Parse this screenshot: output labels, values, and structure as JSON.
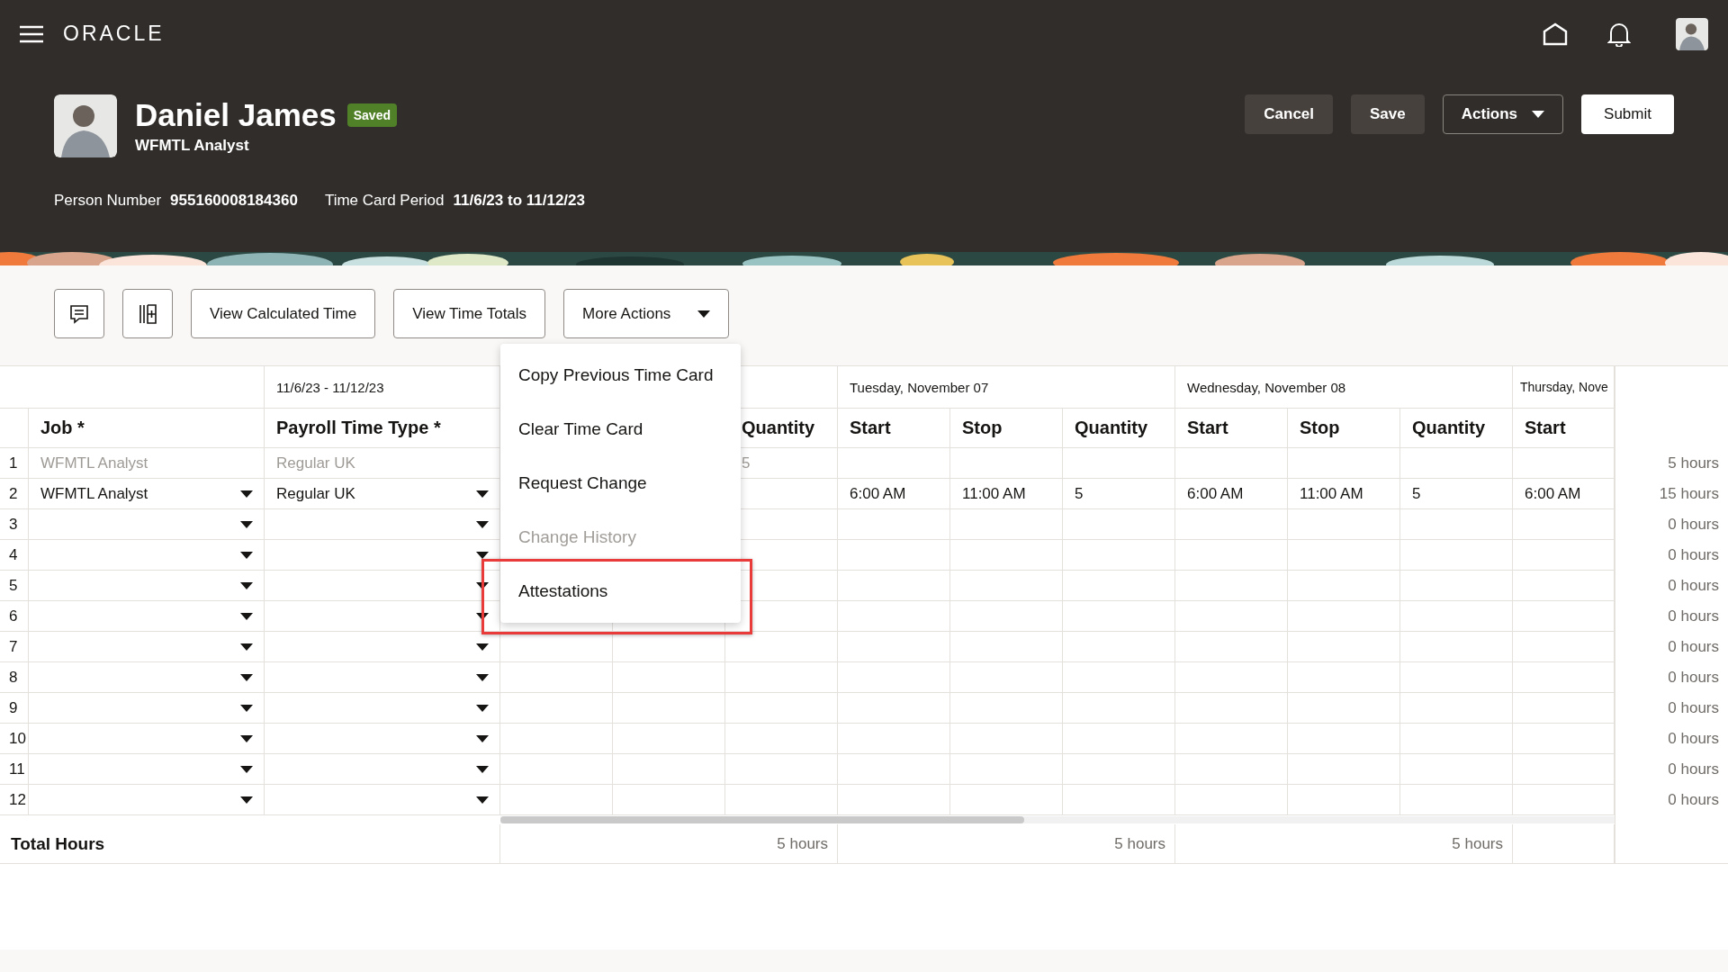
{
  "app_bar": {
    "logo": "ORACLE"
  },
  "person": {
    "name": "Daniel James",
    "status": "Saved",
    "title": "WFMTL Analyst",
    "details": [
      {
        "label": "Person Number",
        "value": "955160008184360"
      },
      {
        "label": "Time Card Period",
        "value": "11/6/23 to 11/12/23"
      }
    ]
  },
  "header_buttons": [
    {
      "label": "Cancel",
      "kind": "secondary"
    },
    {
      "label": "Save",
      "kind": "secondary"
    },
    {
      "label": "Actions",
      "kind": "menu"
    },
    {
      "label": "Submit",
      "kind": "primary"
    }
  ],
  "toolbar": [
    {
      "kind": "comment"
    },
    {
      "kind": "columns"
    },
    {
      "kind": "text",
      "label": "View Calculated Time"
    },
    {
      "kind": "text",
      "label": "View Time Totals"
    },
    {
      "kind": "menu",
      "label": "More Actions"
    }
  ],
  "table": {
    "period_header": "11/6/23 - 11/12/23",
    "day_groups": [
      {
        "label": "Tuesday, November 07"
      },
      {
        "label": "Wednesday, November 08"
      },
      {
        "label": "Thursday, Nove"
      }
    ],
    "columns": [
      "Job *",
      "Payroll Time Type *",
      "Quantity",
      "Start",
      "Stop",
      "Quantity",
      "Start",
      "Stop",
      "Quantity",
      "Start"
    ],
    "rows": [
      {
        "number": "1",
        "job": "WFMTL Analyst",
        "payroll_time_type": "Regular UK",
        "disabled": true,
        "entries": {
          "mon_quantity": "5"
        },
        "total": "5 hours"
      },
      {
        "number": "2",
        "job": "WFMTL Analyst",
        "payroll_time_type": "Regular UK",
        "disabled": false,
        "entries": {
          "tue_start": "6:00 AM",
          "tue_stop": "11:00 AM",
          "tue_quantity": "5",
          "wed_start": "6:00 AM",
          "wed_stop": "11:00 AM",
          "wed_quantity": "5",
          "thu_start": "6:00 AM"
        },
        "total": "15 hours"
      },
      {
        "number": "3",
        "disabled": false,
        "total": "0 hours"
      },
      {
        "number": "4",
        "disabled": false,
        "total": "0 hours"
      },
      {
        "number": "5",
        "disabled": false,
        "total": "0 hours"
      },
      {
        "number": "6",
        "disabled": false,
        "total": "0 hours"
      },
      {
        "number": "7",
        "disabled": false,
        "total": "0 hours"
      },
      {
        "number": "8",
        "disabled": false,
        "total": "0 hours"
      },
      {
        "number": "9",
        "disabled": false,
        "total": "0 hours"
      },
      {
        "number": "10",
        "disabled": false,
        "total": "0 hours"
      },
      {
        "number": "11",
        "disabled": false,
        "total": "0 hours"
      },
      {
        "number": "12",
        "disabled": false,
        "total": "0 hours"
      }
    ],
    "totals": {
      "label": "Total Hours",
      "day_totals": [
        "5 hours",
        "5 hours",
        "5 hours"
      ]
    }
  },
  "menu": {
    "items": [
      {
        "label": "Copy Previous Time Card",
        "disabled": false,
        "highlighted": false
      },
      {
        "label": "Clear Time Card",
        "disabled": false,
        "highlighted": false
      },
      {
        "label": "Request Change",
        "disabled": false,
        "highlighted": false
      },
      {
        "label": "Change History",
        "disabled": true,
        "highlighted": false
      },
      {
        "label": "Attestations",
        "disabled": false,
        "highlighted": true
      }
    ]
  }
}
